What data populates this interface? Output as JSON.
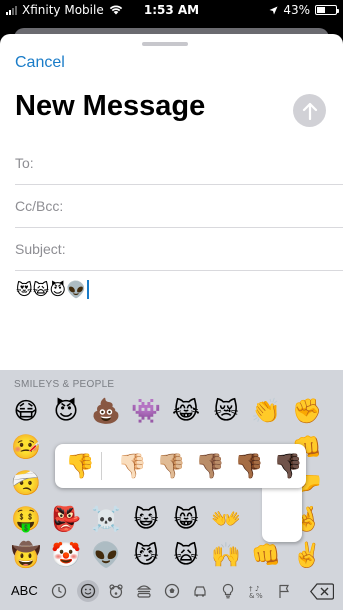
{
  "status_bar": {
    "carrier": "Xfinity Mobile",
    "time": "1:53 AM",
    "battery": "43%",
    "battery_level": 0.43
  },
  "compose": {
    "cancel_label": "Cancel",
    "title": "New Message",
    "to_label": "To:",
    "cc_label": "Cc/Bcc:",
    "subject_label": "Subject:",
    "body_text": "😻🙀😈👽"
  },
  "keyboard": {
    "section_label": "SMILEYS & PEOPLE",
    "abc_label": "ABC",
    "emoji_rows": [
      [
        "😷",
        "😈",
        "💩",
        "👾",
        "😹",
        "😿",
        "👏",
        "✊"
      ],
      [
        "🤒",
        "",
        "",
        "",
        "",
        "",
        "",
        "👊"
      ],
      [
        "🤕",
        "",
        "",
        "",
        "",
        "",
        "",
        "🤛"
      ],
      [
        "🤑",
        "👺",
        "☠️",
        "😺",
        "😸",
        "👐",
        "",
        "🤞"
      ],
      [
        "🤠",
        "🤡",
        "👽",
        "😼",
        "🙀",
        "🙌",
        "👊",
        "✌️"
      ]
    ],
    "categories": [
      "clock-icon",
      "smiley-icon",
      "bear-icon",
      "burger-icon",
      "soccer-ball-icon",
      "car-icon",
      "lightbulb-icon",
      "symbols-icon",
      "flag-icon"
    ]
  },
  "skin_tone_popup": {
    "tones": [
      "👎",
      "👎🏻",
      "👎🏼",
      "👎🏽",
      "👎🏾",
      "👎🏿"
    ]
  }
}
